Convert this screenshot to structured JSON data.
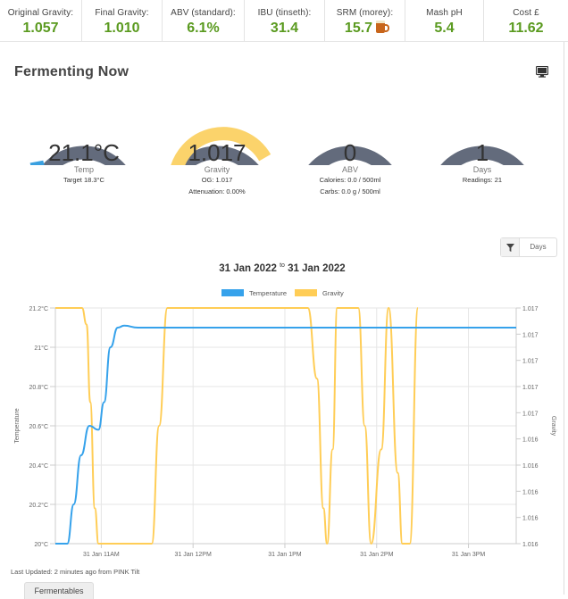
{
  "stats": [
    {
      "label": "Original Gravity:",
      "value": "1.057"
    },
    {
      "label": "Final Gravity:",
      "value": "1.010"
    },
    {
      "label": "ABV (standard):",
      "value": "6.1%"
    },
    {
      "label": "IBU (tinseth):",
      "value": "31.4"
    },
    {
      "label": "SRM (morey):",
      "value": "15.7"
    },
    {
      "label": "Mash pH",
      "value": "5.4"
    },
    {
      "label": "Cost £",
      "value": "11.62"
    }
  ],
  "panel": {
    "title": "Fermenting Now",
    "monitor_icon": "monitor-icon"
  },
  "gauges": {
    "temp": {
      "value": "21.1°C",
      "label": "Temp",
      "sub1": "Target 18.3°C",
      "fill": 0.08,
      "color": "#3aa0e0"
    },
    "gravity": {
      "value": "1.017",
      "label": "Gravity",
      "sub1": "OG: 1.017",
      "sub2": "Attenuation: 0.00%",
      "fill": 0.9,
      "color": "#fbd36b"
    },
    "abv": {
      "value": "0",
      "label": "ABV",
      "sub1": "Calories: 0.0 / 500ml",
      "sub2": "Carbs: 0.0 g / 500ml",
      "fill": 0,
      "color": "#2ecc71"
    },
    "days": {
      "value": "1",
      "label": "Days",
      "sub1": "Readings: 21",
      "fill": 0.04,
      "color": "#2ecc8a"
    }
  },
  "filter": {
    "label": "Days",
    "icon": "filter-icon"
  },
  "date_range": {
    "from": "31 Jan 2022",
    "sep": "to",
    "to": "31 Jan 2022"
  },
  "chart_data": {
    "type": "line",
    "legend": [
      "Temperature",
      "Gravity"
    ],
    "y_left": {
      "label": "Temperature",
      "ticks": [
        "21.2°C",
        "21°C",
        "20.8°C",
        "20.6°C",
        "20.4°C",
        "20.2°C",
        "20°C"
      ],
      "range": [
        20,
        21.2
      ]
    },
    "y_right": {
      "label": "Gravity",
      "ticks": [
        "1.017",
        "1.017",
        "1.017",
        "1.017",
        "1.017",
        "1.016",
        "1.016",
        "1.016",
        "1.016",
        "1.016"
      ]
    },
    "x_ticks": [
      "31 Jan 11AM",
      "31 Jan 12PM",
      "31 Jan 1PM",
      "31 Jan 2PM",
      "31 Jan 3PM"
    ],
    "series": [
      {
        "name": "Temperature",
        "color": "#36a2eb",
        "points": [
          [
            10.5,
            20.0
          ],
          [
            10.63,
            20.0
          ],
          [
            10.7,
            20.2
          ],
          [
            10.78,
            20.45
          ],
          [
            10.87,
            20.6
          ],
          [
            10.97,
            20.58
          ],
          [
            11.03,
            20.72
          ],
          [
            11.1,
            21.0
          ],
          [
            11.18,
            21.1
          ],
          [
            11.25,
            21.11
          ],
          [
            11.4,
            21.1
          ],
          [
            12.0,
            21.1
          ],
          [
            13.0,
            21.1
          ],
          [
            14.0,
            21.1
          ],
          [
            15.0,
            21.1
          ],
          [
            15.52,
            21.1
          ]
        ]
      },
      {
        "name": "Gravity",
        "color": "#ffcd56",
        "points": [
          [
            10.5,
            1
          ],
          [
            10.75,
            1
          ],
          [
            10.79,
            1
          ],
          [
            10.84,
            0.93
          ],
          [
            10.88,
            0.6
          ],
          [
            10.93,
            0.15
          ],
          [
            10.97,
            0
          ],
          [
            11.4,
            0
          ],
          [
            11.55,
            0
          ],
          [
            11.63,
            0.5
          ],
          [
            11.72,
            1
          ],
          [
            13.25,
            1
          ],
          [
            13.35,
            0.7
          ],
          [
            13.42,
            0.15
          ],
          [
            13.46,
            0
          ],
          [
            13.52,
            0.4
          ],
          [
            13.57,
            1
          ],
          [
            13.8,
            1
          ],
          [
            13.87,
            0.5
          ],
          [
            13.94,
            0
          ],
          [
            14.05,
            0.4
          ],
          [
            14.13,
            1
          ],
          [
            14.23,
            0.3
          ],
          [
            14.28,
            0
          ],
          [
            14.36,
            0
          ],
          [
            14.45,
            1
          ]
        ]
      }
    ]
  },
  "footer": {
    "last_updated": "Last Updated: 2 minutes ago from PINK Tilt"
  },
  "tabs": {
    "fermentables": "Fermentables"
  }
}
